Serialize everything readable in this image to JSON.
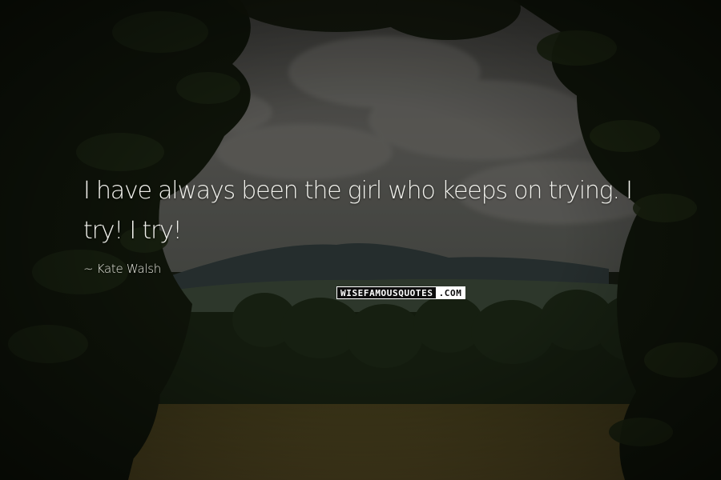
{
  "quote": {
    "text": "I have always been the girl who keeps on trying. I try! I try!"
  },
  "author": {
    "line": "~ Kate Walsh"
  },
  "watermark": {
    "part1": "WISEFAMOUSQUOTES",
    "part2": ".COM"
  },
  "colors": {
    "text": "#f1f1ec",
    "foliage": "#1b2314",
    "sky": "#6b6b66",
    "field": "#6f5f2c"
  }
}
